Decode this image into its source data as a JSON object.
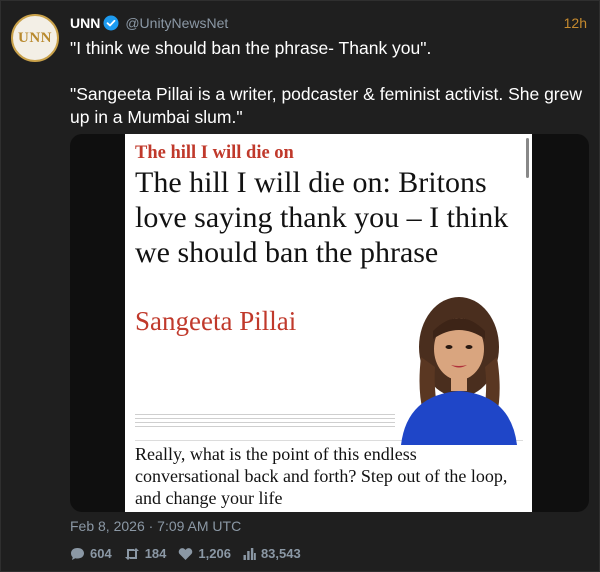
{
  "author": {
    "display_name": "UNN",
    "handle": "@UnityNewsNet",
    "avatar_text": "UNN"
  },
  "time_ago": "12h",
  "text": {
    "line1": "\"I think we should ban the phrase- Thank you\".",
    "line2": "\"Sangeeta Pillai is a writer, podcaster & feminist activist. She grew up in a Mumbai slum.\""
  },
  "article": {
    "kicker": "The hill I will die on",
    "headline": "The hill I will die on: Britons love saying thank you – I think we should ban the phrase",
    "byline": "Sangeeta Pillai",
    "standfirst": "Really, what is the point of this endless conversational back and forth? Step out of the loop, and change your life"
  },
  "posted_date": "Feb 8, 2026 · 7:09 AM UTC",
  "stats": {
    "replies": "604",
    "retweets": "184",
    "likes": "1,206",
    "views": "83,543"
  },
  "colors": {
    "background": "#1f1f1f",
    "accent_time": "#c68a2e",
    "muted": "#8b98a5",
    "verified": "#1d9bf0",
    "guardian_red": "#c0392b"
  },
  "icons": [
    "verified-icon",
    "reply-icon",
    "retweet-icon",
    "like-icon",
    "views-icon"
  ]
}
